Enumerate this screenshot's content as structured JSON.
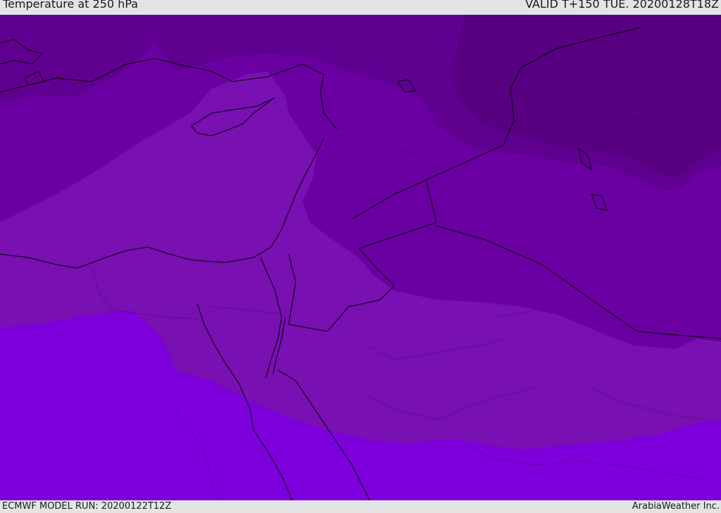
{
  "header": {
    "title": "Temperature at 250 hPa",
    "valid": "VALID T+150 TUE. 20200128T18Z"
  },
  "footer": {
    "model_run": "ECMWF MODEL RUN: 20200122T12Z",
    "credit": "ArabiaWeather Inc."
  },
  "map": {
    "fill_colors": {
      "darkest": "#570082",
      "dark": "#600090",
      "medium": "#6b00a2",
      "light": "#7810b2",
      "bright": "#7d00dc",
      "brightest": "#8a00f0"
    },
    "boundary_color": "#000000"
  }
}
